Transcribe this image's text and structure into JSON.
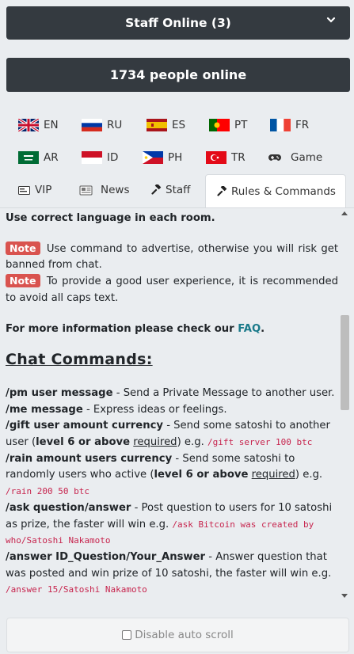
{
  "header": {
    "staff_online": "Staff Online (3)",
    "people_online": "1734 people online"
  },
  "language_tabs": [
    {
      "code": "EN"
    },
    {
      "code": "RU"
    },
    {
      "code": "ES"
    },
    {
      "code": "PT"
    },
    {
      "code": "FR"
    },
    {
      "code": "AR"
    },
    {
      "code": "ID"
    },
    {
      "code": "PH"
    },
    {
      "code": "TR"
    },
    {
      "code": "Game"
    }
  ],
  "section_tabs": {
    "vip": "VIP",
    "news": "News",
    "staff": "Staff",
    "rules": "Rules & Commands"
  },
  "content": {
    "rule_language": "Use correct language in each room.",
    "note_label": "Note",
    "note1": "Use command to advertise, otherwise you will risk get banned from chat.",
    "note2": "To provide a good user experience, it is recommended to avoid all caps text.",
    "more_info": "For more information please check our ",
    "faq": "FAQ",
    "period": ".",
    "heading": "Chat Commands:",
    "commands": [
      {
        "cmd": "/pm user message",
        "desc": " - Send a Private Message to another user."
      },
      {
        "cmd": "/me message",
        "desc": " - Express ideas or feelings."
      },
      {
        "cmd": "/gift user amount currency",
        "desc1": " - Send some satoshi to another user (",
        "level": "level 6 or above",
        "req": "required",
        "desc2": ") e.g. ",
        "example": "/gift server 100 btc"
      },
      {
        "cmd": "/rain amount users currency",
        "desc1": " - Send some satoshi to randomly users who active (",
        "level": "level 6 or above",
        "req": "required",
        "desc2": ") e.g. ",
        "example": "/rain 200 50 btc"
      },
      {
        "cmd": "/ask question/answer",
        "desc": " - Post question to users for 10 satoshi as prize, the faster will win e.g. ",
        "example": "/ask Bitcoin was created by who/Satoshi Nakamoto"
      },
      {
        "cmd": "/answer ID_Question/Your_Answer",
        "desc": " - Answer question that was posted and win prize of 10 satoshi, the faster will win e.g. ",
        "example": "/answer 15/Satoshi Nakamoto"
      }
    ]
  },
  "footer": {
    "auto_scroll": "Disable auto scroll"
  }
}
